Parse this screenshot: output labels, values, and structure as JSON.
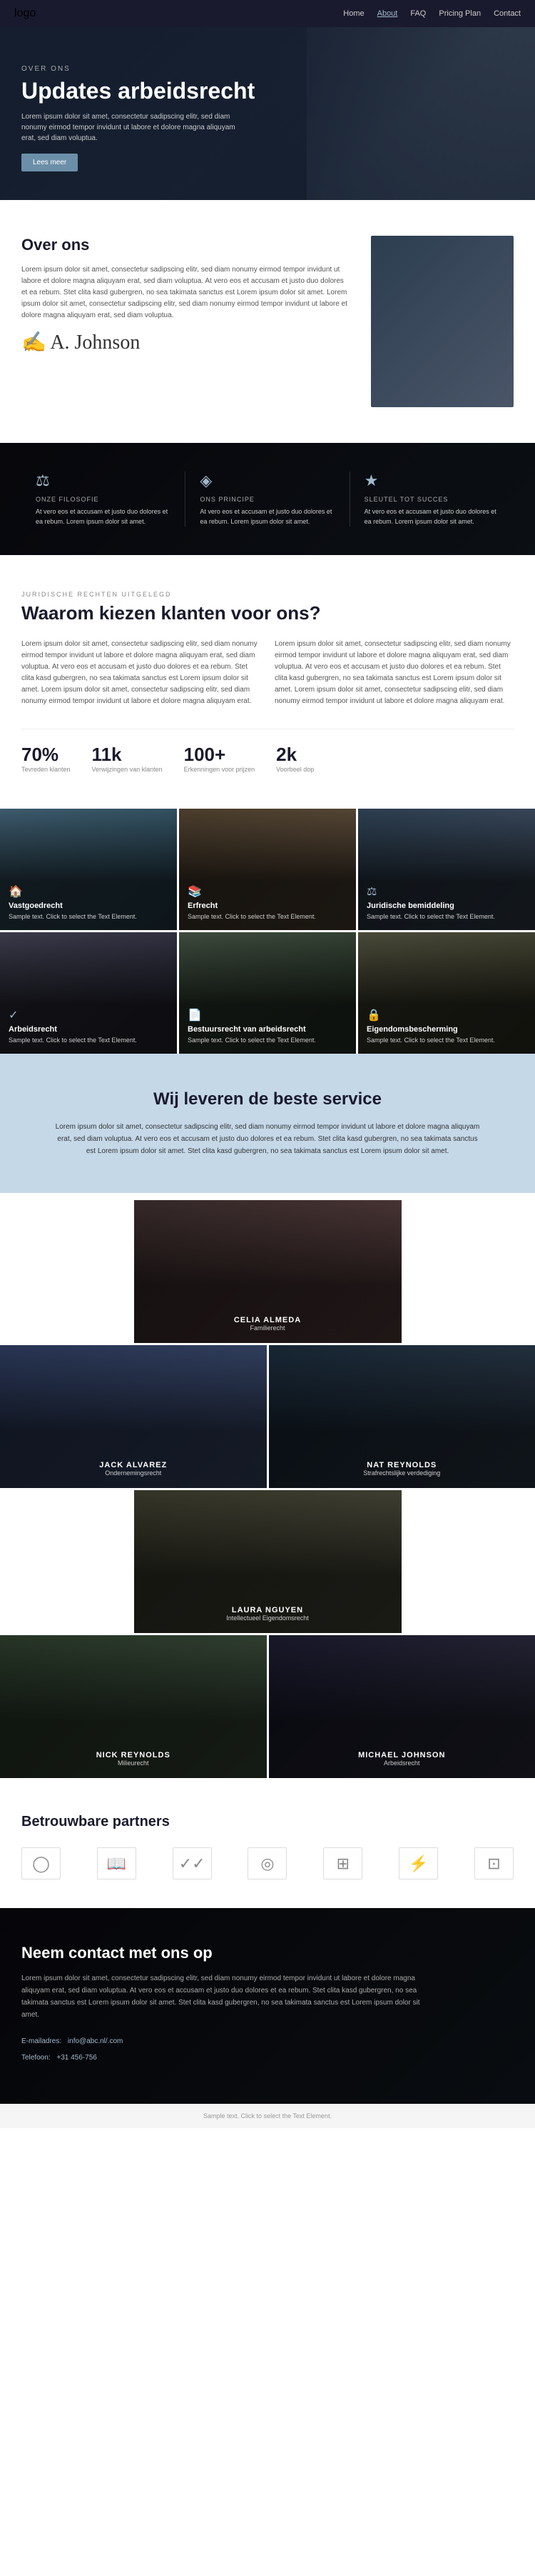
{
  "nav": {
    "logo": "logo",
    "links": [
      "Home",
      "About",
      "FAQ",
      "Pricing Plan",
      "Contact"
    ],
    "active": "About"
  },
  "hero": {
    "over_ons": "OVER ONS",
    "title": "Updates arbeidsrecht",
    "description": "Lorem ipsum dolor sit amet, consectetur sadipscing elitr, sed diam nonumy eirmod tempor invidunt ut labore et dolore magna aliquyam erat, sed diam voluptua.",
    "button": "Lees meer"
  },
  "about": {
    "title": "Over ons",
    "text1": "Lorem ipsum dolor sit amet, consectetur sadipscing elitr, sed diam nonumy eirmod tempor invidunt ut labore et dolore magna aliquyam erat, sed diam voluptua. At vero eos et accusam et justo duo dolores et ea rebum. Stet clita kasd gubergren, no sea takimata sanctus est Lorem ipsum dolor sit amet. Lorem ipsum dolor sit amet, consectetur sadipscing elitr, sed diam nonumy eirmod tempor invidunt ut labore et dolore magna aliquyam erat, sed diam voluptua.",
    "signature": "A. Johnson"
  },
  "banner": {
    "items": [
      {
        "icon": "⚖",
        "label": "ONZE FILOSOFIE",
        "text": "At vero eos et accusam et justo duo dolores et ea rebum. Lorem ipsum dolor sit amet."
      },
      {
        "icon": "◈",
        "label": "ONS PRINCIPE",
        "text": "At vero eos et accusam et justo duo dolores et ea rebum. Lorem ipsum dolor sit amet."
      },
      {
        "icon": "★",
        "label": "SLEUTEL TOT SUCCES",
        "text": "At vero eos et accusam et justo duo dolores et ea rebum. Lorem ipsum dolor sit amet."
      }
    ]
  },
  "why": {
    "sub_label": "JURIDISCHE RECHTEN UITGELEGD",
    "title": "Waarom kiezen klanten voor ons?",
    "col1": "Lorem ipsum dolor sit amet, consectetur sadipscing elitr, sed diam nonumy eirmod tempor invidunt ut labore et dolore magna aliquyam erat, sed diam voluptua. At vero eos et accusam et justo duo dolores et ea rebum. Stet clita kasd gubergren, no sea takimata sanctus est Lorem ipsum dolor sit amet. Lorem ipsum dolor sit amet, consectetur sadipscing elitr, sed diam nonumy eirmod tempor invidunt ut labore et dolore magna aliquyam erat.",
    "col2": "Lorem ipsum dolor sit amet, consectetur sadipscing elitr, sed diam nonumy eirmod tempor invidunt ut labore et dolore magna aliquyam erat, sed diam voluptua. At vero eos et accusam et justo duo dolores et ea rebum. Stet clita kasd gubergren, no sea takimata sanctus est Lorem ipsum dolor sit amet. Lorem ipsum dolor sit amet, consectetur sadipscing elitr, sed diam nonumy eirmod tempor invidunt ut labore et dolore magna aliquyam erat.",
    "stats": [
      {
        "num": "70%",
        "label": "Tevreden klanten"
      },
      {
        "num": "11k",
        "label": "Verwijzingen van klanten"
      },
      {
        "num": "100+",
        "label": "Erkenningen voor prijzen"
      },
      {
        "num": "2k",
        "label": "Voorbeel dop"
      }
    ]
  },
  "services": {
    "cards": [
      {
        "icon": "🏠",
        "title": "Vastgoedrecht",
        "text": "Sample text. Click to select the Text Element."
      },
      {
        "icon": "📚",
        "title": "Erfrecht",
        "text": "Sample text. Click to select the Text Element."
      },
      {
        "icon": "⚖",
        "title": "Juridische bemiddeling",
        "text": "Sample text. Click to select the Text Element."
      },
      {
        "icon": "✓",
        "title": "Arbeidsrecht",
        "text": "Sample text. Click to select the Text Element."
      },
      {
        "icon": "📄",
        "title": "Bestuursrecht van arbeidsrecht",
        "text": "Sample text. Click to select the Text Element."
      },
      {
        "icon": "🔒",
        "title": "Eigendomsbescherming",
        "text": "Sample text. Click to select the Text Element."
      }
    ]
  },
  "service_section": {
    "title": "Wij leveren de beste service",
    "text": "Lorem ipsum dolor sit amet, consectetur sadipscing elitr, sed diam nonumy eirmod tempor invidunt ut labore et dolore magna aliquyam erat, sed diam voluptua. At vero eos et accusam et justo duo dolores et ea rebum. Stet clita kasd gubergren, no sea takimata sanctus est Lorem ipsum dolor sit amet. Stet clita kasd gubergren, no sea takimata sanctus est Lorem ipsum dolor sit amet."
  },
  "team": {
    "members": [
      {
        "name": "CELIA ALMEDA",
        "role": "Familierecht",
        "color": "tc-1"
      },
      {
        "name": "JACK ALVAREZ",
        "role": "Ondernemingsrecht",
        "color": "tc-2"
      },
      {
        "name": "NAT REYNOLDS",
        "role": "Strafrechtslijke verdediging",
        "color": "tc-3"
      },
      {
        "name": "LAURA NGUYEN",
        "role": "Intellectueel Eigendomsrecht",
        "color": "tc-4"
      },
      {
        "name": "NICK REYNOLDS",
        "role": "Milieurecht",
        "color": "tc-5"
      },
      {
        "name": "MICHAEL JOHNSON",
        "role": "Arbeidsrecht",
        "color": "tc-6"
      }
    ]
  },
  "partners": {
    "title": "Betrouwbare partners",
    "logos": [
      "◯",
      "📖",
      "✓✓",
      "◎",
      "⊞",
      "⚡",
      "⊡"
    ]
  },
  "contact": {
    "title": "Neem contact met ons op",
    "text": "Lorem ipsum dolor sit amet, consectetur sadipscing elitr, sed diam nonumy eirmod tempor invidunt ut labore et dolore magna aliquyam erat, sed diam voluptua. At vero eos et accusam et justo duo dolores et ea rebum. Stet clita kasd gubergren, no sea takimata sanctus est Lorem ipsum dolor sit amet. Stet clita kasd gubergren, no sea takimata sanctus est Lorem ipsum dolor sit amet.",
    "email_label": "E-mailadres:",
    "email": "info@abc.nl/.com",
    "phone_label": "Telefoon:",
    "phone": "+31 456-756"
  },
  "footer": {
    "sample": "Sample text. Click to select the Text Element."
  }
}
